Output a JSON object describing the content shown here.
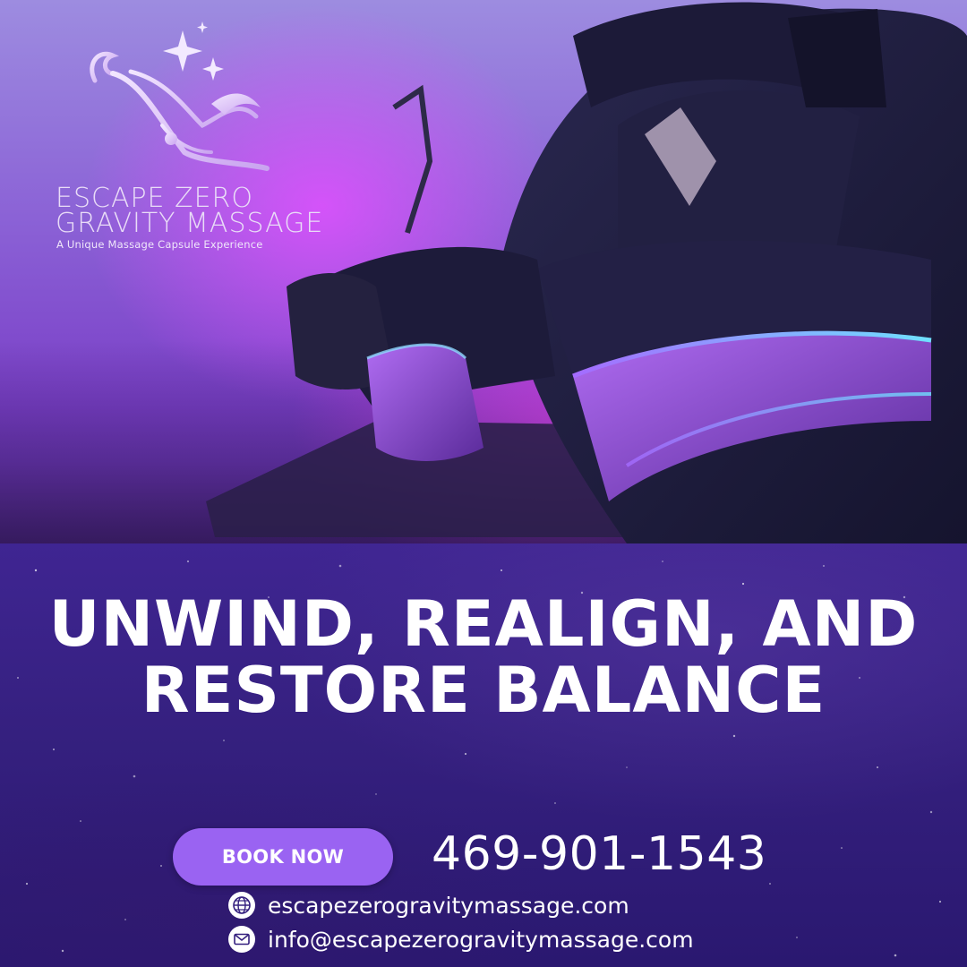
{
  "brand": {
    "name_line1": "ESCAPE ZERO",
    "name_line2": "GRAVITY MASSAGE",
    "tagline": "A Unique Massage Capsule Experience"
  },
  "headline": {
    "line1": "UNWIND, REALIGN, AND",
    "line2": "RESTORE BALANCE"
  },
  "cta": {
    "book_label": "BOOK NOW",
    "phone": "469-901-1543"
  },
  "contact": {
    "website": "escapezerogravitymassage.com",
    "email": "info@escapezerogravitymassage.com",
    "website_icon": "globe-icon",
    "email_icon": "mail-icon"
  },
  "colors": {
    "panel_background": "#35207f",
    "button": "#9a63f2",
    "text": "#ffffff",
    "brand_text": "#e9dcf7"
  }
}
